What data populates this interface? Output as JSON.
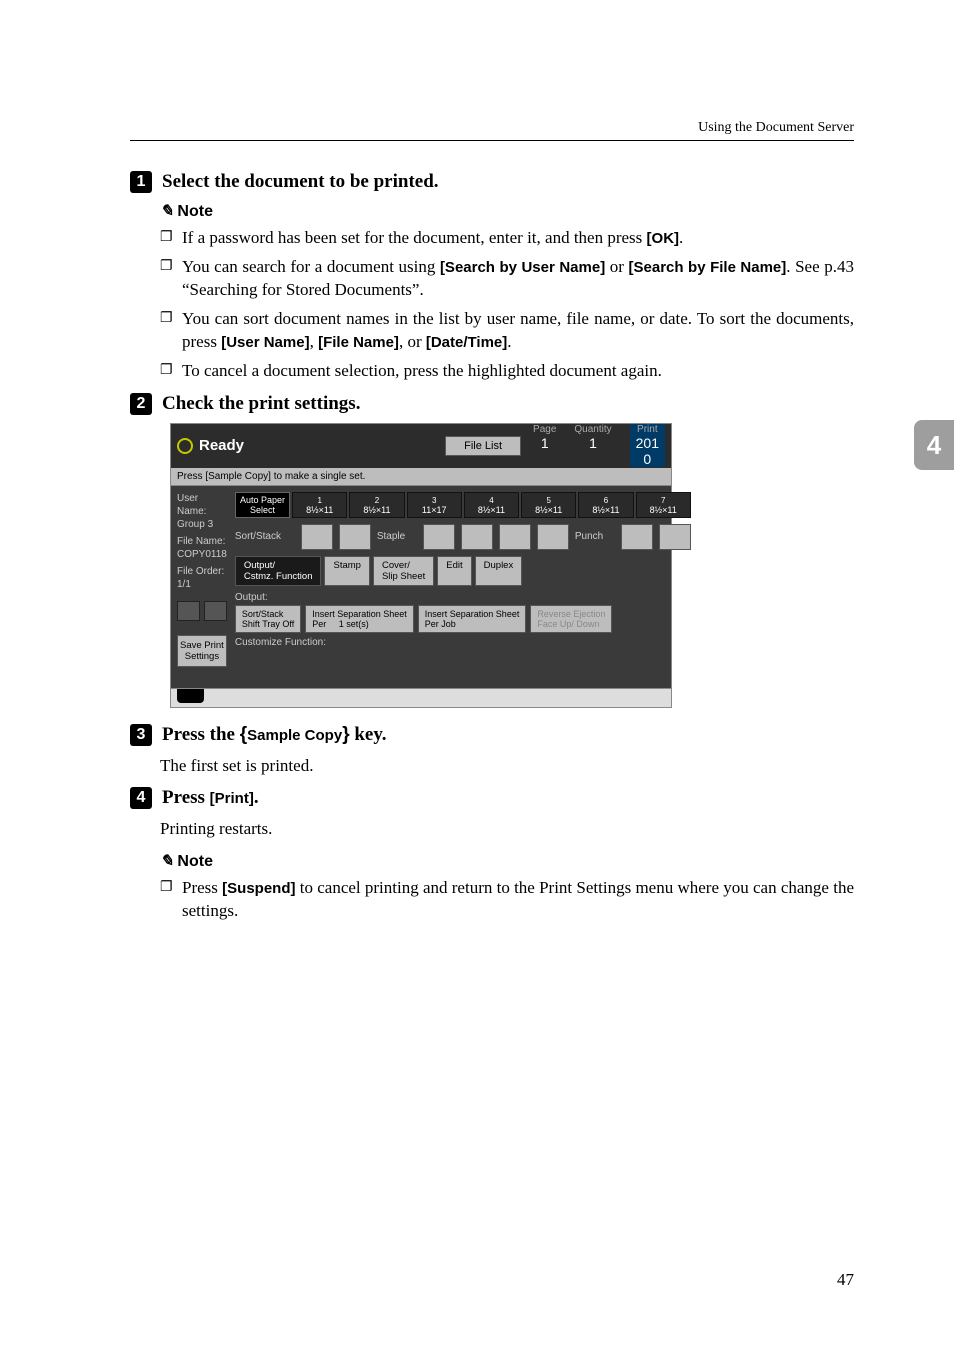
{
  "header": {
    "right": "Using the Document Server"
  },
  "sideTab": "4",
  "steps": {
    "s1": {
      "num": "1",
      "text": "Select the document to be printed."
    },
    "s2": {
      "num": "2",
      "text": "Check the print settings."
    },
    "s3": {
      "num": "3",
      "prefix": "Press the ",
      "key": "Sample Copy",
      "suffix": " key."
    },
    "s4": {
      "num": "4",
      "prefix": "Press ",
      "btn": "[Print]",
      "suffix": "."
    }
  },
  "noteLabel": "Note",
  "notes1": {
    "a_pre": "If a password has been set for the document, enter it, and then press ",
    "a_btn": "[OK]",
    "a_post": ".",
    "b_pre": "You can search for a document using ",
    "b_btn1": "[Search by User Name]",
    "b_mid": " or ",
    "b_btn2": "[Search by File Name]",
    "b_post": ". See p.43 “Searching for Stored Documents”.",
    "c_pre": "You can sort document names in the list by user name, file name, or date. To sort the documents, press ",
    "c_btn1": "[User Name]",
    "c_sep1": ", ",
    "c_btn2": "[File Name]",
    "c_sep2": ", or ",
    "c_btn3": "[Date/Time]",
    "c_post": ".",
    "d": "To cancel a document selection, press the highlighted document again."
  },
  "afterStep3": "The first set is printed.",
  "afterStep4": "Printing restarts.",
  "notes2": {
    "a_pre": "Press ",
    "a_btn": "[Suspend]",
    "a_post": " to cancel printing and return to the Print Settings menu where you can change the settings."
  },
  "pageNumber": "47",
  "screenshot": {
    "ready": "Ready",
    "fileList": "File List",
    "pageLab": "Page",
    "pageVal": "1",
    "qtyLab": "Quantity",
    "qtyVal": "1",
    "printLab": "Print",
    "printVal": "201\n0",
    "hint": "Press [Sample Copy] to make a single set.",
    "left": {
      "userNameLab": "User Name:",
      "userNameVal": "Group 3",
      "fileNameLab": "File Name:",
      "fileNameVal": "COPY0118",
      "fileOrderLab": "File Order:",
      "fileOrderVal": "1/1",
      "save": "Save Print Settings"
    },
    "trays": {
      "autoPaper": "Auto Paper\nSelect",
      "t1": "1",
      "t2": "2",
      "t3": "3",
      "t4": "4",
      "t5": "5",
      "t6": "6",
      "t7": "7",
      "size_a": "8½×11",
      "size_b": "11×17"
    },
    "labels": {
      "sortStack": "Sort/Stack",
      "staple": "Staple",
      "punch": "Punch",
      "outputFunc": "Output/\nCstmz. Function",
      "stamp": "Stamp",
      "coverSlip": "Cover/\nSlip Sheet",
      "edit": "Edit",
      "duplex": "Duplex",
      "output": "Output:",
      "sortStackBtn": "Sort/Stack\nShift Tray Off",
      "insSep1": "Insert Separation Sheet\nPer     1 set(s)",
      "insSep2": "Insert Separation Sheet\nPer Job",
      "revEject": "Reverse Ejection\nFace Up/ Down",
      "custFunc": "Customize Function:"
    }
  }
}
